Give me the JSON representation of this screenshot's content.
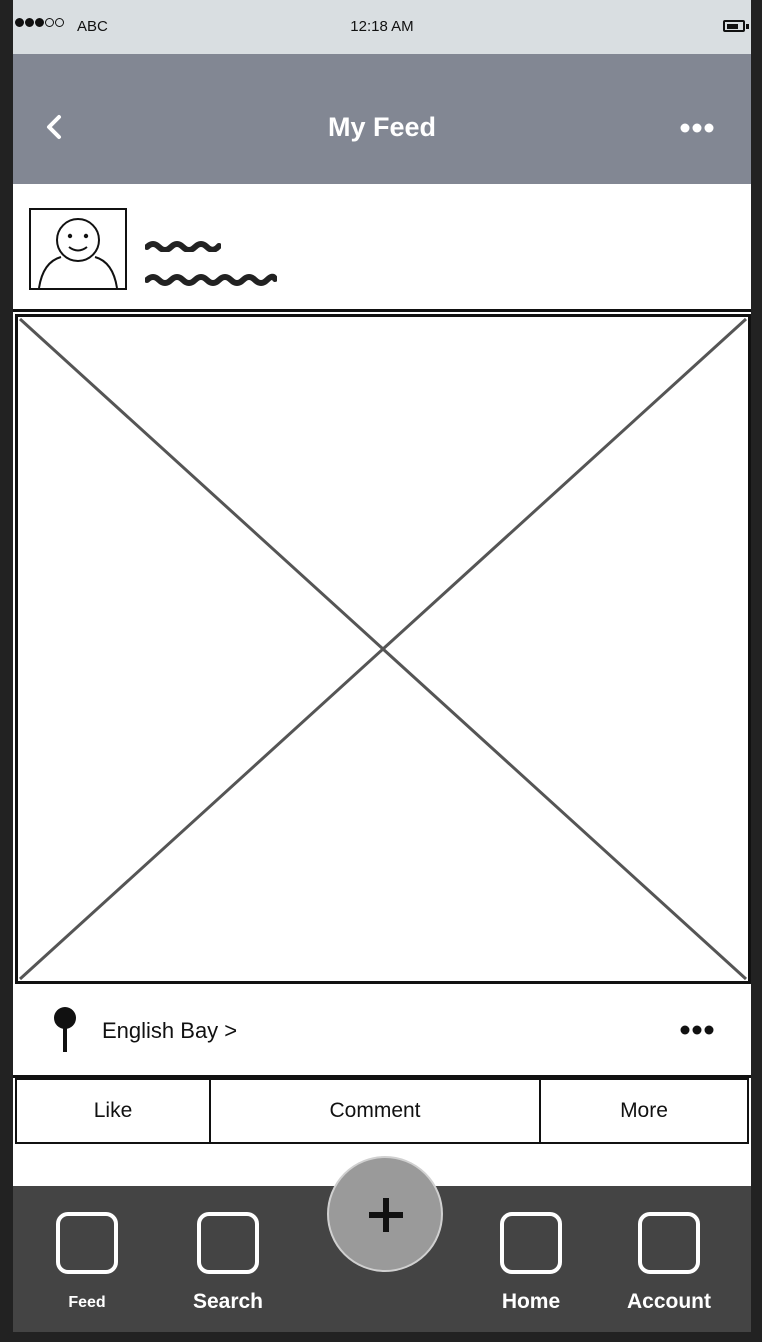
{
  "status_bar": {
    "signal_icon": "signal-dots-icon",
    "carrier": "ABC",
    "time": "12:18 AM",
    "battery_icon": "battery-icon"
  },
  "nav": {
    "back_icon": "chevron-left-icon",
    "title": "My Feed",
    "more_icon": "ellipsis-icon"
  },
  "post": {
    "avatar_icon": "user-avatar-icon",
    "image_placeholder": "image-placeholder-icon",
    "location": "English Bay >",
    "location_icon": "map-pin-icon"
  },
  "actions": {
    "like": "Like",
    "comment": "Comment",
    "more": "More"
  },
  "tabbar": {
    "feed": "Feed",
    "search": "Search",
    "home": "Home",
    "account": "Account",
    "add_icon": "plus-icon"
  },
  "colors": {
    "nav_bg": "#828793",
    "status_bg": "#d9dee1",
    "tabbar_bg": "#444444",
    "fab_bg": "#9a9a9a"
  }
}
